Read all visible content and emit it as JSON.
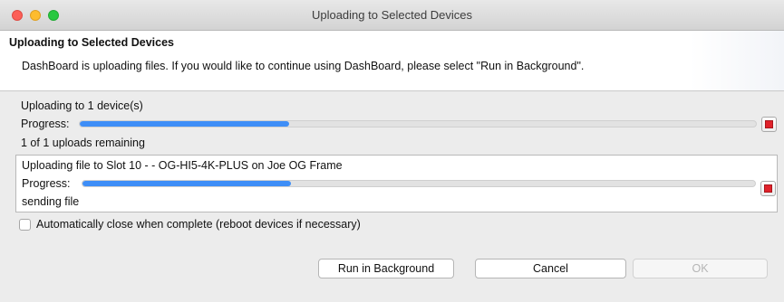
{
  "window": {
    "title": "Uploading to Selected Devices"
  },
  "banner": {
    "title": "Uploading to Selected Devices",
    "message": "DashBoard is uploading files.  If you would like to continue using DashBoard, please select \"Run in Background\"."
  },
  "overall": {
    "heading": "Uploading to 1 device(s)",
    "progress_label": "Progress:",
    "progress_fraction": 0.31,
    "remaining": "1 of 1 uploads remaining"
  },
  "file": {
    "title": "Uploading file to Slot 10 -  - OG-HI5-4K-PLUS on Joe OG Frame",
    "progress_label": "Progress:",
    "progress_fraction": 0.31,
    "status": "sending file"
  },
  "options": {
    "auto_close_label": "Automatically close when complete (reboot devices if necessary)",
    "auto_close_checked": false
  },
  "buttons": {
    "run_background": "Run in Background",
    "cancel": "Cancel",
    "ok": "OK"
  },
  "colors": {
    "progress_fill": "#3e8ef7",
    "stop_red": "#e0212a"
  }
}
